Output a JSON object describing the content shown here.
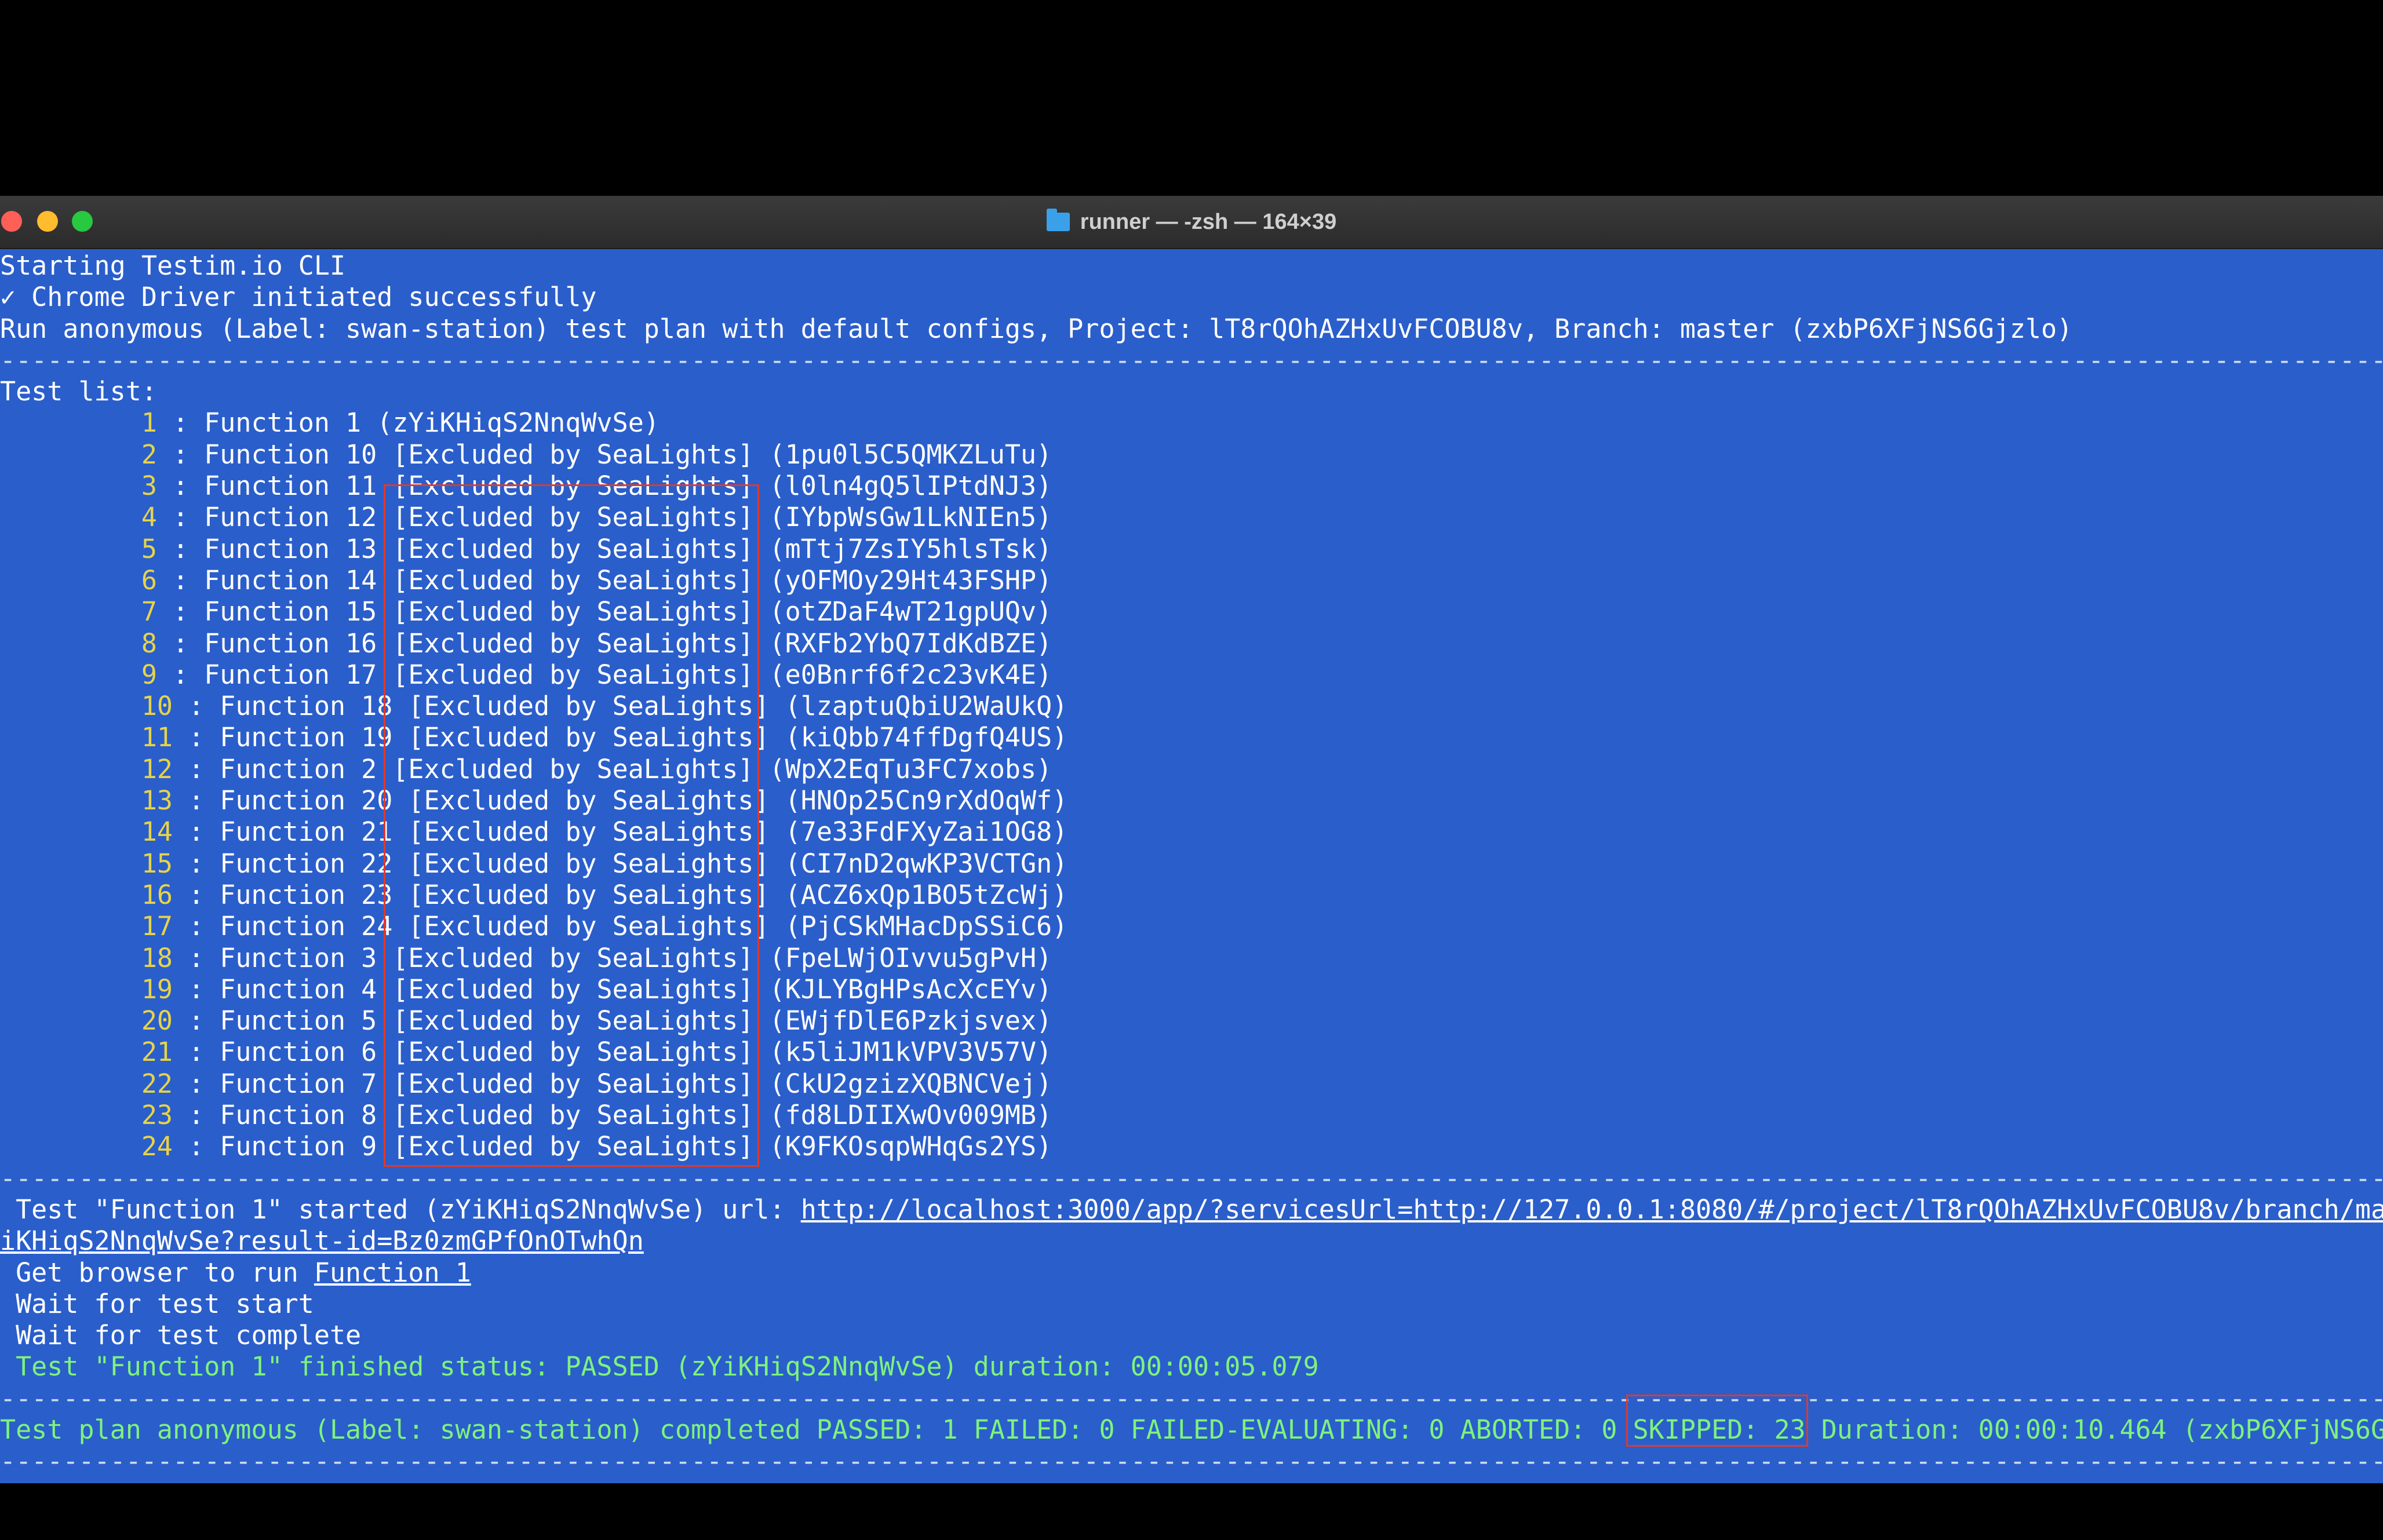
{
  "window": {
    "title": "runner — -zsh — 164×39",
    "background": "#2a5ecb",
    "icons": [
      "folder-icon"
    ]
  },
  "terminal": {
    "header_lines": [
      "Starting Testim.io CLI",
      "✓ Chrome Driver initiated successfully",
      "Run anonymous (Label: swan-station) test plan with default configs, Project: lT8rQOhAZHxUvFCOBU8v, Branch: master (zxbP6XFjNS6Gjzlo)"
    ],
    "separator": "------------------------------------------------------------------------------------------------------------------------------------------------------------------------------------",
    "test_list_label": "Test list:",
    "tests": [
      {
        "prefix": "         ",
        "num": "1",
        "text": " : Function 1 (zYiKHiqS2NnqWvSe)"
      },
      {
        "prefix": "         ",
        "num": "2",
        "text": " : Function 10 [Excluded by SeaLights] (1pu0l5C5QMKZLuTu)"
      },
      {
        "prefix": "         ",
        "num": "3",
        "text": " : Function 11 [Excluded by SeaLights] (l0ln4gQ5lIPtdNJ3)"
      },
      {
        "prefix": "         ",
        "num": "4",
        "text": " : Function 12 [Excluded by SeaLights] (IYbpWsGw1LkNIEn5)"
      },
      {
        "prefix": "         ",
        "num": "5",
        "text": " : Function 13 [Excluded by SeaLights] (mTtj7ZsIY5hlsTsk)"
      },
      {
        "prefix": "         ",
        "num": "6",
        "text": " : Function 14 [Excluded by SeaLights] (yOFMOy29Ht43FSHP)"
      },
      {
        "prefix": "         ",
        "num": "7",
        "text": " : Function 15 [Excluded by SeaLights] (otZDaF4wT21gpUQv)"
      },
      {
        "prefix": "         ",
        "num": "8",
        "text": " : Function 16 [Excluded by SeaLights] (RXFb2YbQ7IdKdBZE)"
      },
      {
        "prefix": "         ",
        "num": "9",
        "text": " : Function 17 [Excluded by SeaLights] (e0Bnrf6f2c23vK4E)"
      },
      {
        "prefix": "         ",
        "num": "10",
        "text": " : Function 18 [Excluded by SeaLights] (lzaptuQbiU2WaUkQ)"
      },
      {
        "prefix": "         ",
        "num": "11",
        "text": " : Function 19 [Excluded by SeaLights] (kiQbb74ffDgfQ4US)"
      },
      {
        "prefix": "         ",
        "num": "12",
        "text": " : Function 2 [Excluded by SeaLights] (WpX2EqTu3FC7xobs)"
      },
      {
        "prefix": "         ",
        "num": "13",
        "text": " : Function 20 [Excluded by SeaLights] (HNOp25Cn9rXdOqWf)"
      },
      {
        "prefix": "         ",
        "num": "14",
        "text": " : Function 21 [Excluded by SeaLights] (7e33FdFXyZai1OG8)"
      },
      {
        "prefix": "         ",
        "num": "15",
        "text": " : Function 22 [Excluded by SeaLights] (CI7nD2qwKP3VCTGn)"
      },
      {
        "prefix": "         ",
        "num": "16",
        "text": " : Function 23 [Excluded by SeaLights] (ACZ6xQp1BO5tZcWj)"
      },
      {
        "prefix": "         ",
        "num": "17",
        "text": " : Function 24 [Excluded by SeaLights] (PjCSkMHacDpSSiC6)"
      },
      {
        "prefix": "         ",
        "num": "18",
        "text": " : Function 3 [Excluded by SeaLights] (FpeLWjOIvvu5gPvH)"
      },
      {
        "prefix": "         ",
        "num": "19",
        "text": " : Function 4 [Excluded by SeaLights] (KJLYBgHPsAcXcEYv)"
      },
      {
        "prefix": "         ",
        "num": "20",
        "text": " : Function 5 [Excluded by SeaLights] (EWjfDlE6Pzkjsvex)"
      },
      {
        "prefix": "         ",
        "num": "21",
        "text": " : Function 6 [Excluded by SeaLights] (k5liJM1kVPV3V57V)"
      },
      {
        "prefix": "         ",
        "num": "22",
        "text": " : Function 7 [Excluded by SeaLights] (CkU2gzizXQBNCVej)"
      },
      {
        "prefix": "         ",
        "num": "23",
        "text": " : Function 8 [Excluded by SeaLights] (fd8LDIIXwOv009MB)"
      },
      {
        "prefix": "         ",
        "num": "24",
        "text": " : Function 9 [Excluded by SeaLights] (K9FKOsqpWHqGs2YS)"
      }
    ],
    "run": {
      "started_prefix": " Test \"Function 1\" started (zYiKHiqS2NnqWvSe) url: ",
      "url_part1": "http://localhost:3000/app/?servicesUrl=http://127.0.0.1:8080/#/project/lT8rQOhAZHxUvFCOBU8v/branch/ma",
      "url_part2": "iKHiqS2NnqWvSe?result-id=Bz0zmGPfOnOTwhQn",
      "get_browser_prefix": " Get browser to run ",
      "get_browser_link": "Function 1",
      "wait_start": " Wait for test start",
      "wait_complete": " Wait for test complete",
      "finished": " Test \"Function 1\" finished status: PASSED (zYiKHiqS2NnqWvSe) duration: 00:00:05.079"
    },
    "summary": {
      "before": "Test plan anonymous (Label: swan-station) completed PASSED: 1 FAILED: 0 FAILED-EVALUATING: 0 ABORTED: 0 ",
      "skipped": "SKIPPED: 23",
      "after": " Duration: 00:00:10.464 (zxbP6XFjNS6G"
    }
  },
  "colors": {
    "terminal_bg": "#2a5ecb",
    "number": "#e6d34a",
    "success_green": "#7ef27e",
    "highlight_box": "#e0392b"
  }
}
